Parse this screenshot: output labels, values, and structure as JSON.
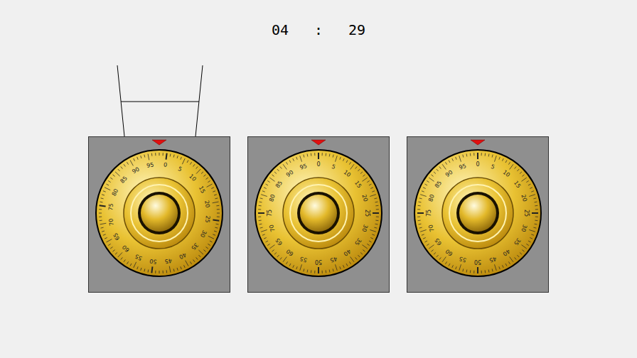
{
  "timer": {
    "minutes": "04",
    "separator": ":",
    "seconds": "29"
  },
  "dials": [
    {
      "selected": true,
      "level": 0.02,
      "labels": [
        "0",
        "5",
        "10",
        "15",
        "20",
        "25",
        "30",
        "35",
        "40",
        "45",
        "50",
        "55",
        "60",
        "65",
        "70",
        "75",
        "80",
        "85",
        "90",
        "95"
      ]
    },
    {
      "selected": false,
      "level": 0,
      "labels": [
        "0",
        "5",
        "10",
        "15",
        "20",
        "25",
        "30",
        "35",
        "40",
        "45",
        "50",
        "55",
        "60",
        "65",
        "70",
        "75",
        "80",
        "85",
        "90",
        "95"
      ]
    },
    {
      "selected": false,
      "level": 0,
      "labels": [
        "0",
        "5",
        "10",
        "15",
        "20",
        "25",
        "30",
        "35",
        "40",
        "45",
        "50",
        "55",
        "60",
        "65",
        "70",
        "75",
        "80",
        "85",
        "90",
        "95"
      ]
    }
  ]
}
